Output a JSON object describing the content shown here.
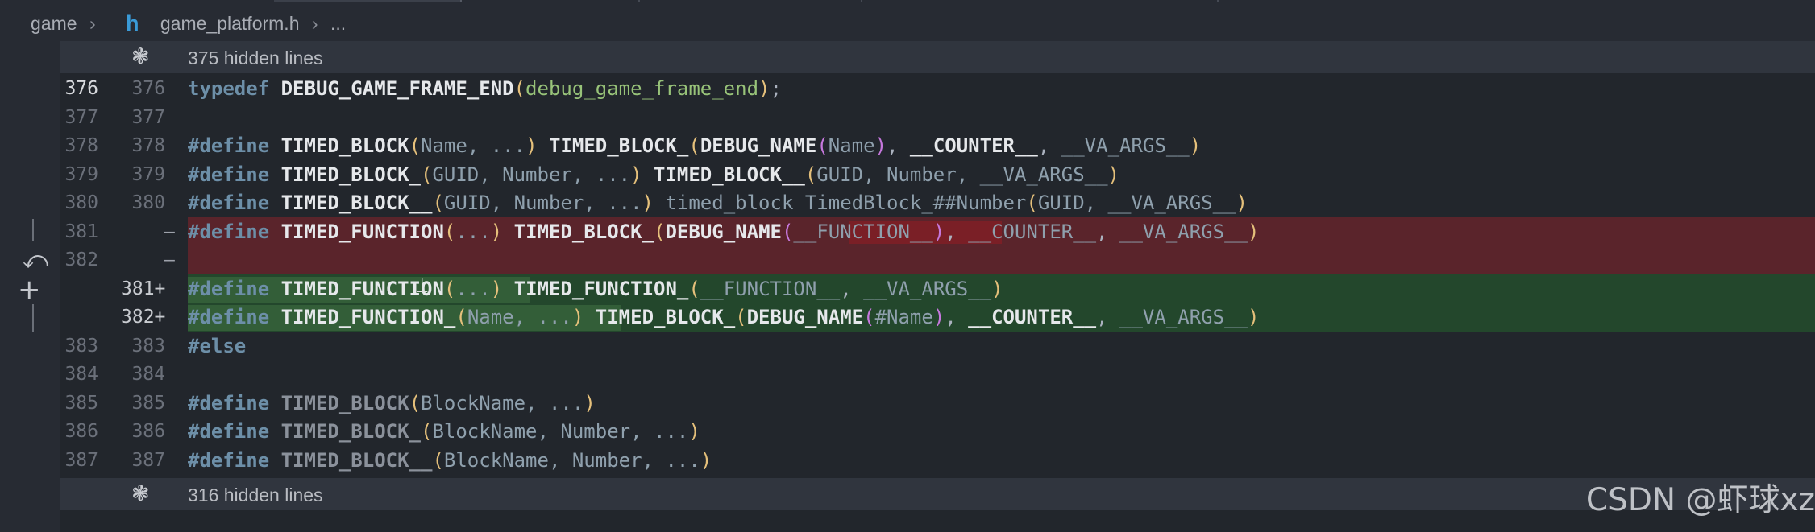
{
  "breadcrumb": {
    "folder": "game",
    "file": "game_platform.h",
    "more": "..."
  },
  "hidden_top": {
    "label": "375 hidden lines"
  },
  "hidden_bottom": {
    "label": "316 hidden lines"
  },
  "lines": {
    "l376": {
      "old": "376",
      "new": "376"
    },
    "l377": {
      "old": "377",
      "new": "377"
    },
    "l378": {
      "old": "378",
      "new": "378"
    },
    "l379": {
      "old": "379",
      "new": "379"
    },
    "l380": {
      "old": "380",
      "new": "380"
    },
    "l381d": {
      "old": "381",
      "marker": "—"
    },
    "l382d": {
      "old": "382",
      "marker": "—"
    },
    "l381a": {
      "new": "381+"
    },
    "l382a": {
      "new": "382+"
    },
    "l383": {
      "old": "383",
      "new": "383"
    },
    "l384": {
      "old": "384",
      "new": "384"
    },
    "l385": {
      "old": "385",
      "new": "385"
    },
    "l386": {
      "old": "386",
      "new": "386"
    },
    "l387": {
      "old": "387",
      "new": "387"
    }
  },
  "code": {
    "typedef": "typedef",
    "define": "#define",
    "else": "#else",
    "c376_name": "DEBUG_GAME_FRAME_END",
    "c376_arg": "debug_game_frame_end",
    "tb": "TIMED_BLOCK",
    "tb_": "TIMED_BLOCK_",
    "tb__": "TIMED_BLOCK__",
    "tf": "TIMED_FUNCTION",
    "tf_": "TIMED_FUNCTION_",
    "dbgname": "DEBUG_NAME",
    "counter": "__COUNTER__",
    "va": "__VA_ARGS__",
    "func": "__FUNCTION__",
    "c378_args": "Name, ...",
    "c378_name": "Name",
    "c379_args": "GUID, Number, ...",
    "c379_inner": "GUID, Number, ",
    "c380_args": "GUID, Number, ...",
    "c380_tb": "timed_block TimedBlock_##Number",
    "c380_inner": "GUID, ",
    "ell": "...",
    "c382a_args": "Name, ...",
    "c382a_name": "#Name",
    "c385_args": "BlockName, ...",
    "c386_args": "BlockName, Number, ...",
    "c387_args": "BlockName, Number, ..."
  },
  "watermark": "CSDN @虾球xz",
  "colors": {
    "deleted_bg": "#5a242b",
    "added_bg": "#23472c",
    "keyword": "#6d8fa8",
    "string_arg": "#98c379"
  }
}
